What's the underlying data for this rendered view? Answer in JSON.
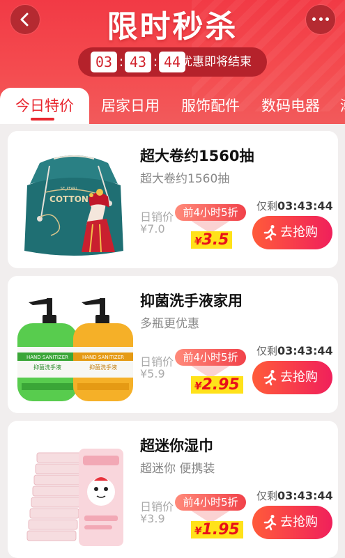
{
  "header": {
    "title": "限时秒杀",
    "timer": {
      "hours": "03",
      "minutes": "43",
      "seconds": "44",
      "label": "优惠即将结束"
    }
  },
  "tabs": [
    "今日特价",
    "居家日用",
    "服饰配件",
    "数码电器",
    "潮"
  ],
  "products": [
    {
      "name": "超大卷约1560抽",
      "subtitle": "超大卷约1560抽",
      "daily_label": "日销价",
      "daily_price": "¥7.0",
      "promo_tag": "前4小时5折",
      "price_symbol": "¥",
      "price": "3.5",
      "remaining_label": "仅剩",
      "remaining_time": "03:43:44",
      "buy_label": "去抢购",
      "image_text": {
        "brand": "COTTON",
        "small": "SE_PEARL"
      }
    },
    {
      "name": "抑菌洗手液家用",
      "subtitle": "多瓶更优惠",
      "daily_label": "日销价",
      "daily_price": "¥5.9",
      "promo_tag": "前4小时5折",
      "price_symbol": "¥",
      "price": "2.95",
      "remaining_label": "仅剩",
      "remaining_time": "03:43:44",
      "buy_label": "去抢购",
      "image_text": {
        "brand": "HAND SANITIZER",
        "cn": "抑菌洗手液"
      }
    },
    {
      "name": "超迷你湿巾",
      "subtitle": "超迷你 便携装",
      "daily_label": "日销价",
      "daily_price": "¥3.9",
      "promo_tag": "前4小时5折",
      "price_symbol": "¥",
      "price": "1.95",
      "remaining_label": "仅剩",
      "remaining_time": "03:43:44",
      "buy_label": "去抢购"
    }
  ],
  "colors": {
    "accent": "#e8262e",
    "header": "#f23a45",
    "price_bg": "#ffe21a",
    "button_start": "#ff5b3a",
    "button_end": "#f0205b"
  }
}
